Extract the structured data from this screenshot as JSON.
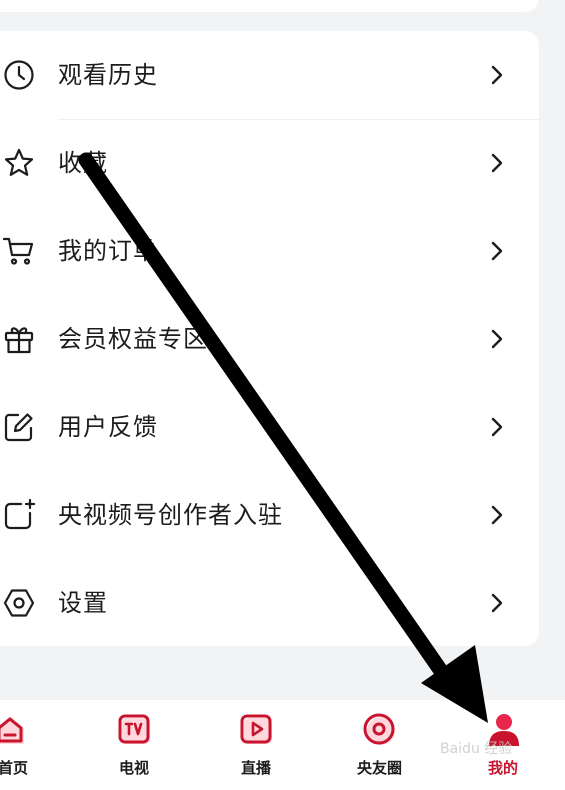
{
  "menu": {
    "items": [
      {
        "label": "观看历史",
        "icon": "clock-icon"
      },
      {
        "label": "收藏",
        "icon": "star-icon"
      },
      {
        "label": "我的订单",
        "icon": "cart-icon"
      },
      {
        "label": "会员权益专区",
        "icon": "gift-icon"
      },
      {
        "label": "用户反馈",
        "icon": "edit-icon"
      },
      {
        "label": "央视频号创作者入驻",
        "icon": "add-square-icon"
      },
      {
        "label": "设置",
        "icon": "settings-icon"
      }
    ]
  },
  "tabbar": {
    "tabs": [
      {
        "label": "首页",
        "icon": "home-icon"
      },
      {
        "label": "电视",
        "icon": "tv-icon"
      },
      {
        "label": "直播",
        "icon": "play-icon"
      },
      {
        "label": "央友圈",
        "icon": "circle-icon"
      },
      {
        "label": "我的",
        "icon": "user-icon",
        "active": true
      }
    ]
  },
  "colors": {
    "brand": "#c8142d",
    "background": "#f2f3f5",
    "text": "#1c1c1c",
    "annotation_arrow": "#000000"
  }
}
